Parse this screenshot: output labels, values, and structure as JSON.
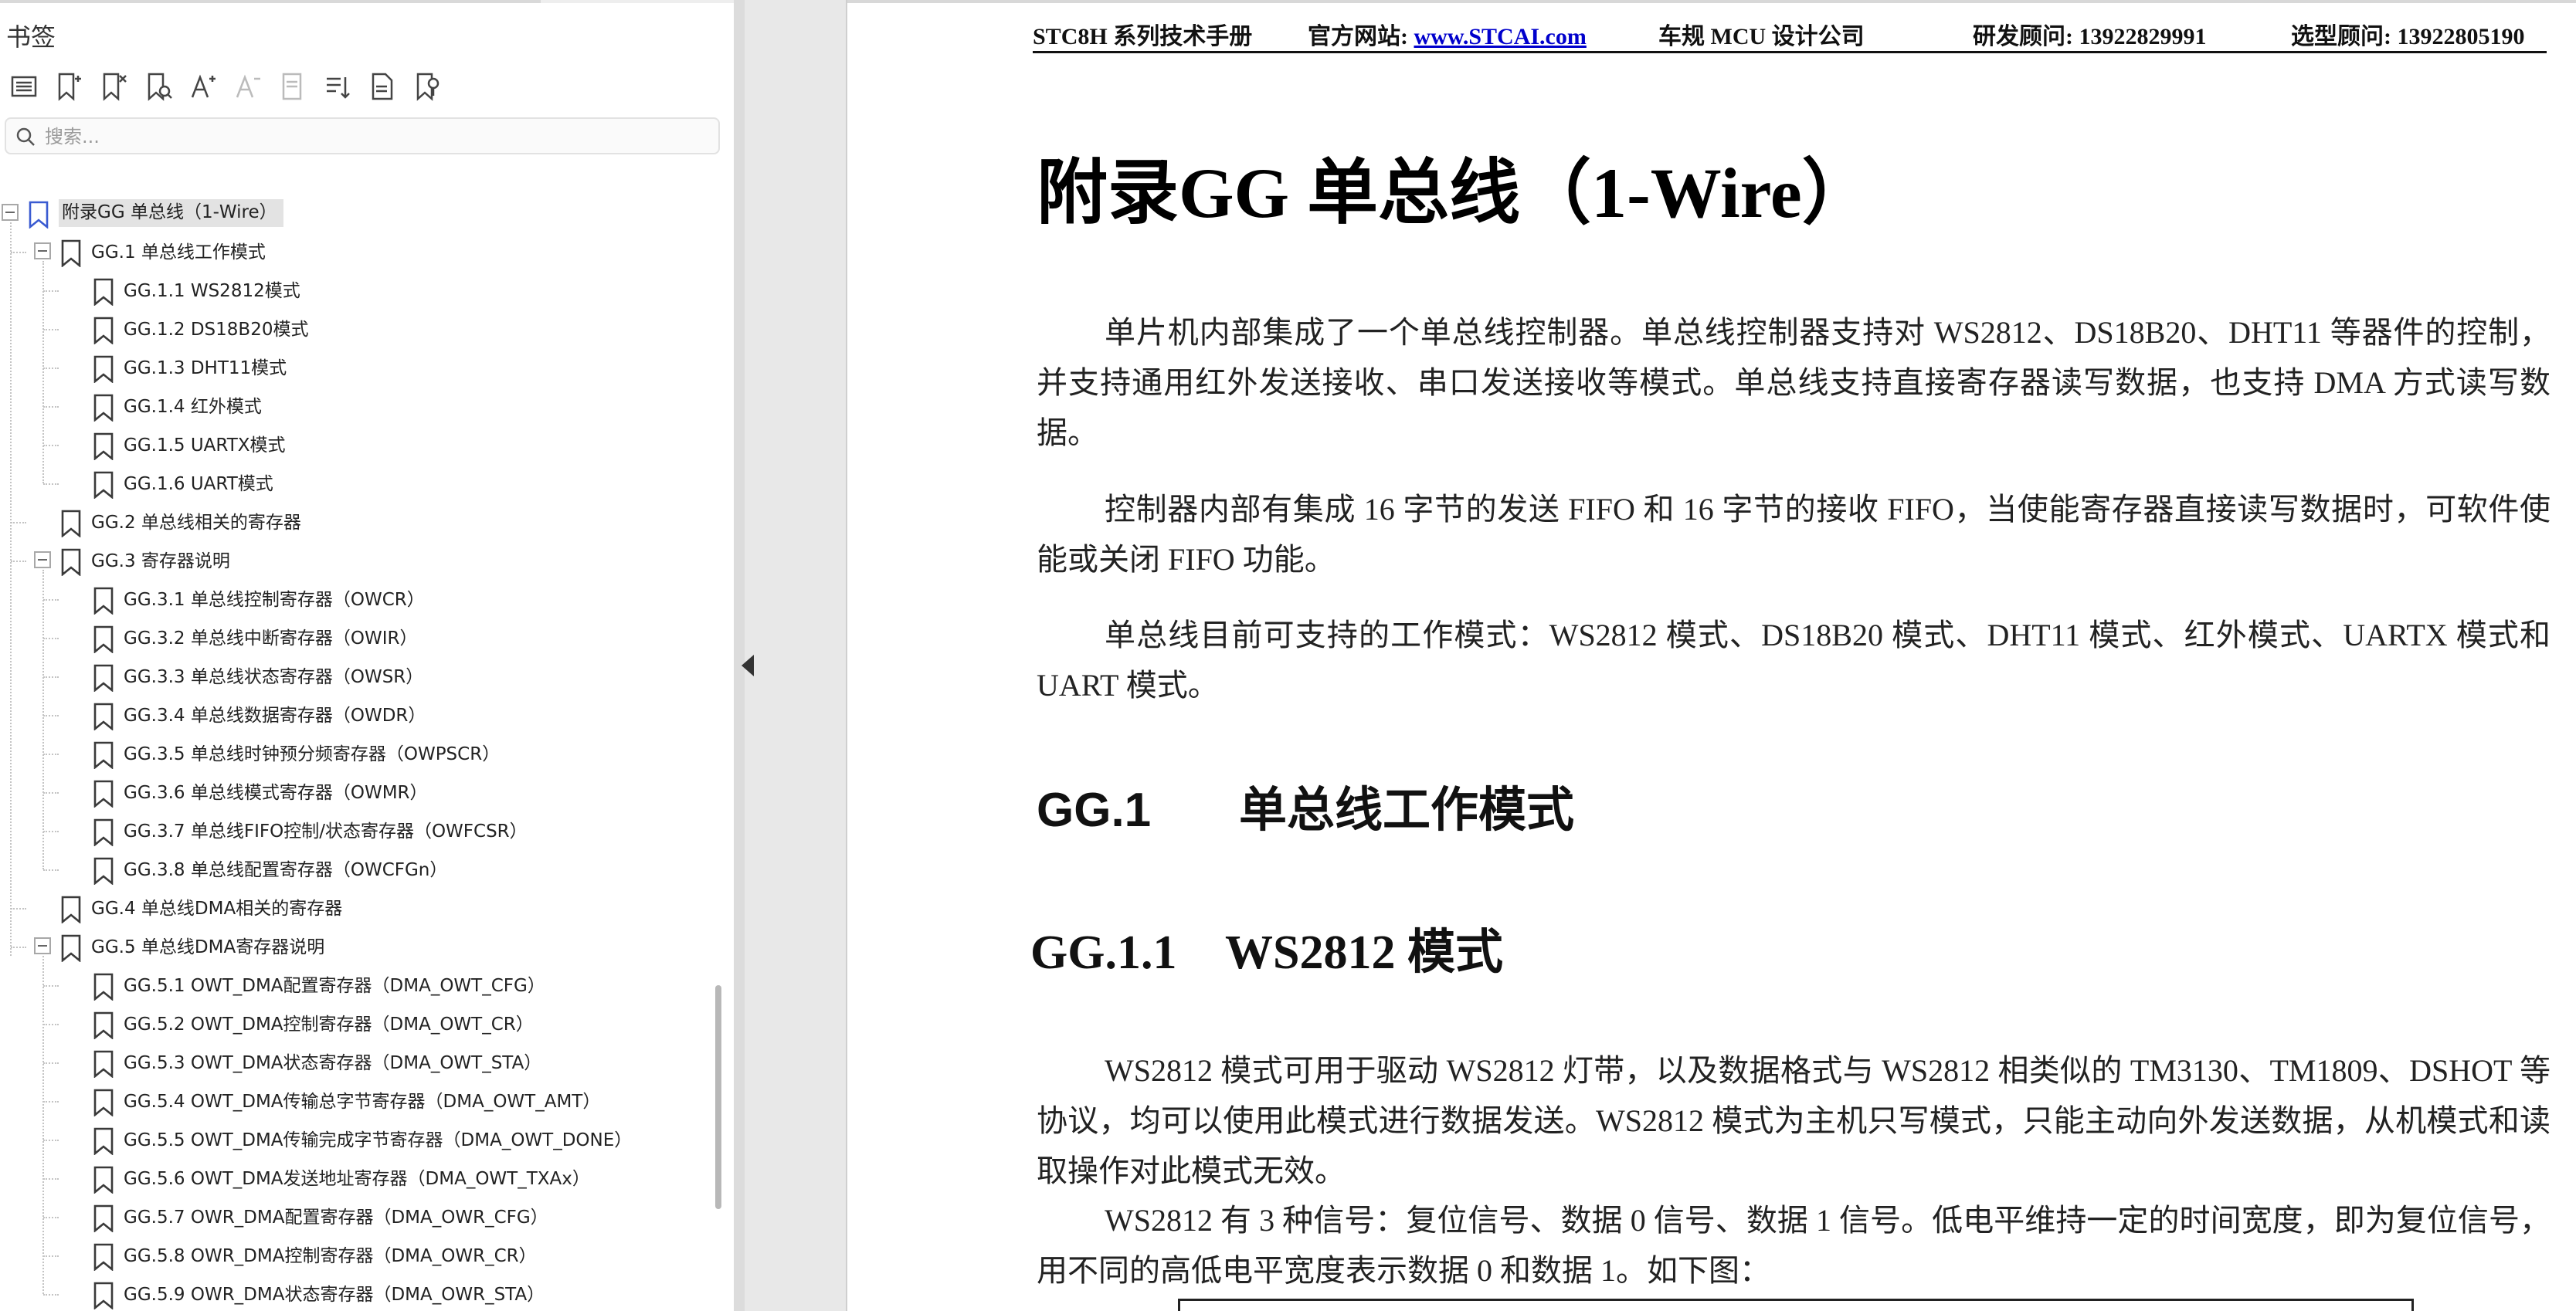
{
  "sidebar": {
    "title": "书签",
    "search_placeholder": "搜索...",
    "toolbar": [
      {
        "name": "expand-all-icon"
      },
      {
        "name": "add-bookmark-icon"
      },
      {
        "name": "delete-bookmark-icon"
      },
      {
        "name": "find-bookmark-icon"
      },
      {
        "name": "font-larger-icon"
      },
      {
        "name": "font-smaller-icon"
      },
      {
        "name": "bookmark-properties-icon"
      },
      {
        "name": "sort-bookmarks-icon"
      },
      {
        "name": "bookmark-from-page-icon"
      },
      {
        "name": "bookmark-search-icon"
      }
    ],
    "bookmarks": [
      {
        "label": "附录GG  单总线（1-Wire）",
        "level": 0,
        "expanded": true,
        "selected": true
      },
      {
        "label": "GG.1 单总线工作模式",
        "level": 1,
        "expanded": true
      },
      {
        "label": "GG.1.1 WS2812模式",
        "level": 2
      },
      {
        "label": "GG.1.2 DS18B20模式",
        "level": 2
      },
      {
        "label": "GG.1.3 DHT11模式",
        "level": 2
      },
      {
        "label": "GG.1.4 红外模式",
        "level": 2
      },
      {
        "label": "GG.1.5 UARTX模式",
        "level": 2
      },
      {
        "label": "GG.1.6  UART模式",
        "level": 2
      },
      {
        "label": "GG.2  单总线相关的寄存器",
        "level": 1
      },
      {
        "label": "GG.3  寄存器说明",
        "level": 1,
        "expanded": true
      },
      {
        "label": "GG.3.1 单总线控制寄存器（OWCR）",
        "level": 2
      },
      {
        "label": "GG.3.2  单总线中断寄存器（OWIR）",
        "level": 2
      },
      {
        "label": "GG.3.3 单总线状态寄存器（OWSR）",
        "level": 2
      },
      {
        "label": "GG.3.4 单总线数据寄存器（OWDR）",
        "level": 2
      },
      {
        "label": "GG.3.5 单总线时钟预分频寄存器（OWPSCR）",
        "level": 2
      },
      {
        "label": "GG.3.6 单总线模式寄存器（OWMR）",
        "level": 2
      },
      {
        "label": "GG.3.7  单总线FIFO控制/状态寄存器（OWFCSR）",
        "level": 2
      },
      {
        "label": "GG.3.8 单总线配置寄存器（OWCFGn）",
        "level": 2
      },
      {
        "label": "GG.4  单总线DMA相关的寄存器",
        "level": 1
      },
      {
        "label": "GG.5  单总线DMA寄存器说明",
        "level": 1,
        "expanded": true
      },
      {
        "label": "GG.5.1 OWT_DMA配置寄存器（DMA_OWT_CFG）",
        "level": 2
      },
      {
        "label": "GG.5.2 OWT_DMA控制寄存器（DMA_OWT_CR）",
        "level": 2
      },
      {
        "label": "GG.5.3 OWT_DMA状态寄存器（DMA_OWT_STA）",
        "level": 2
      },
      {
        "label": "GG.5.4  OWT_DMA传输总字节寄存器（DMA_OWT_AMT）",
        "level": 2
      },
      {
        "label": "GG.5.5 OWT_DMA传输完成字节寄存器（DMA_OWT_DONE）",
        "level": 2
      },
      {
        "label": "GG.5.6 OWT_DMA发送地址寄存器（DMA_OWT_TXAx）",
        "level": 2
      },
      {
        "label": "GG.5.7 OWR_DMA配置寄存器（DMA_OWR_CFG）",
        "level": 2
      },
      {
        "label": "GG.5.8  OWR_DMA控制寄存器（DMA_OWR_CR）",
        "level": 2
      },
      {
        "label": "GG.5.9 OWR_DMA状态寄存器（DMA_OWR_STA）",
        "level": 2
      }
    ]
  },
  "page": {
    "header": {
      "manual": "STC8H 系列技术手册",
      "site_label": "官方网站: ",
      "site_link": "www.STCAI.com",
      "company": "车规 MCU 设计公司",
      "rd_contact": "研发顾问: 13922829991",
      "sel_contact": "选型顾问: 13922805190"
    },
    "chapter_title": "附录GG  单总线（1-Wire）",
    "paragraphs": [
      "单片机内部集成了一个单总线控制器。单总线控制器支持对 WS2812、DS18B20、DHT11 等器件的控制，并支持通用红外发送接收、串口发送接收等模式。单总线支持直接寄存器读写数据，也支持 DMA 方式读写数据。",
      "控制器内部有集成 16 字节的发送 FIFO 和 16 字节的接收 FIFO，当使能寄存器直接读写数据时，可软件使能或关闭 FIFO 功能。",
      "单总线目前可支持的工作模式：WS2812 模式、DS18B20 模式、DHT11 模式、红外模式、UARTX 模式和 UART 模式。"
    ],
    "section": {
      "number": "GG.1",
      "title": "单总线工作模式"
    },
    "subsection": {
      "number": "GG.1.1",
      "title": "WS2812 模式"
    },
    "sub_paragraphs": [
      "WS2812 模式可用于驱动 WS2812 灯带，以及数据格式与 WS2812 相类似的 TM3130、TM1809、DSHOT 等协议，均可以使用此模式进行数据发送。WS2812 模式为主机只写模式，只能主动向外发送数据，从机模式和读取操作对此模式无效。",
      "WS2812 有 3 种信号：复位信号、数据 0 信号、数据 1 信号。低电平维持一定的时间宽度，即为复位信号，用不同的高低电平宽度表示数据 0 和数据 1。如下图："
    ]
  }
}
